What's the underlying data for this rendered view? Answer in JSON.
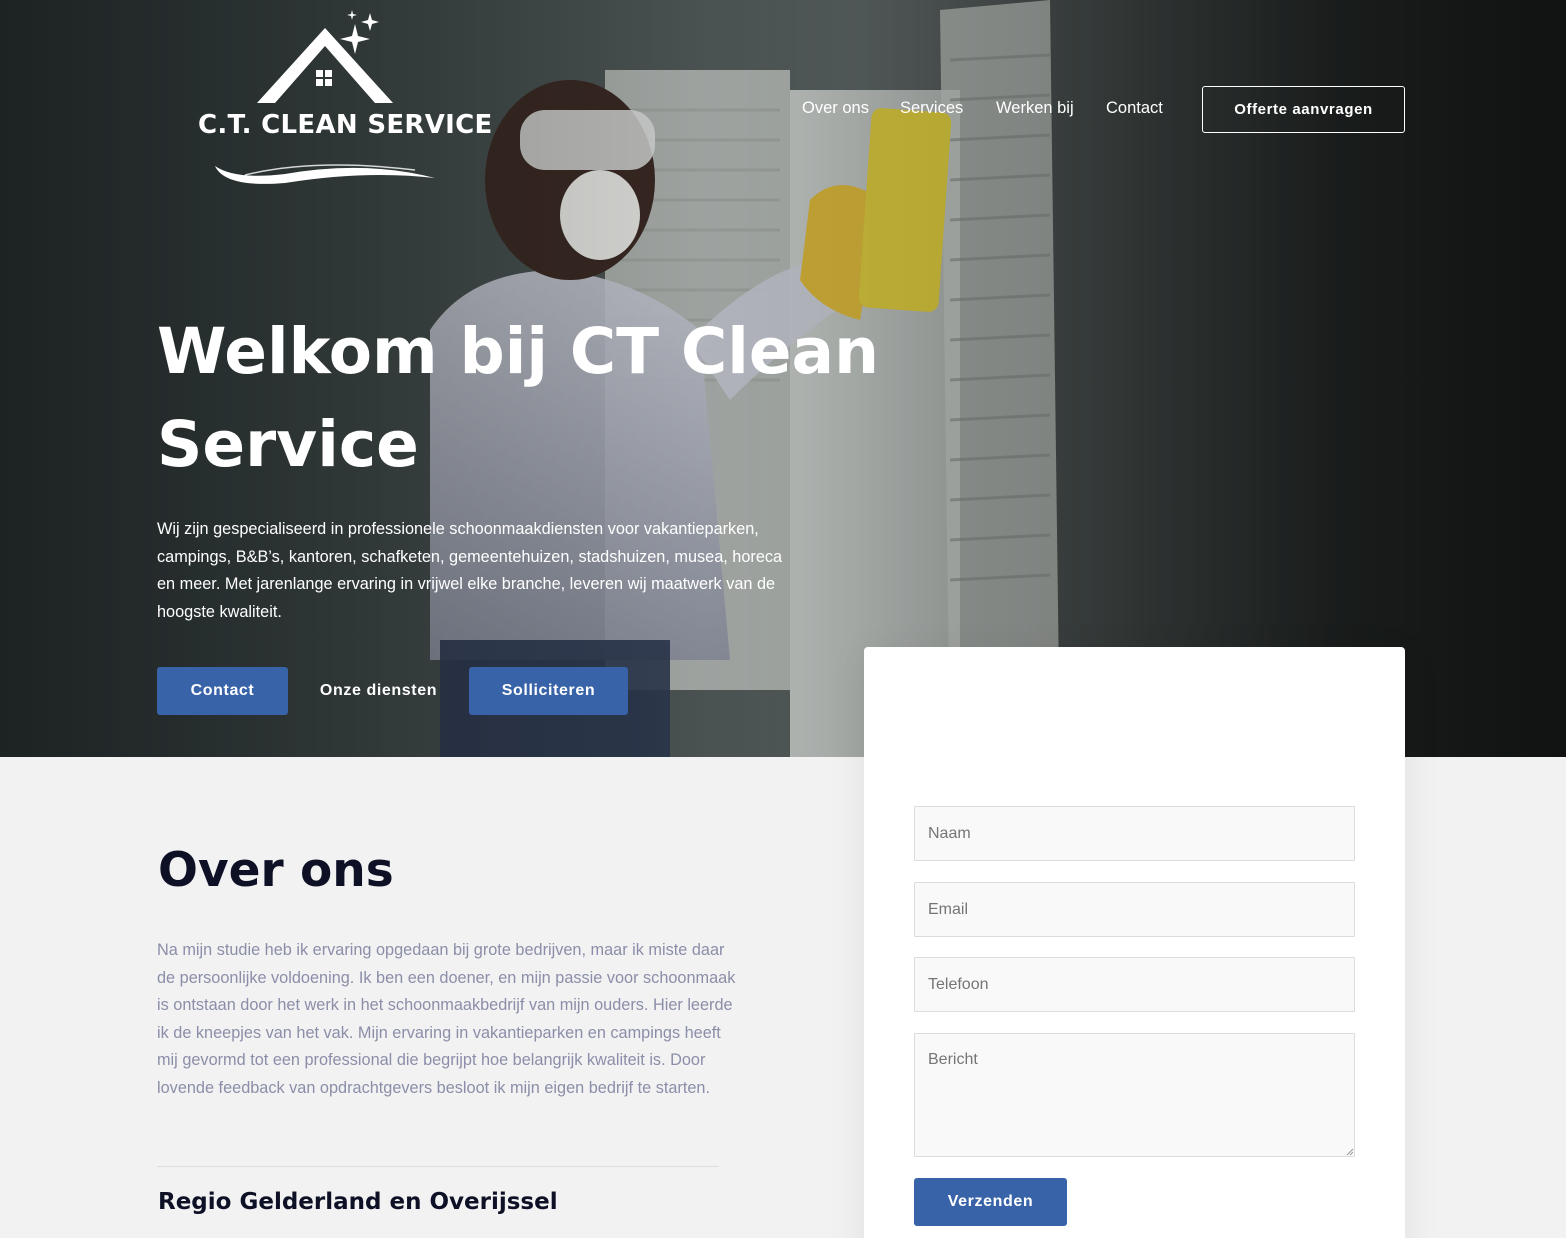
{
  "brand": {
    "logo_text": "C.T. CLEAN SERVICE"
  },
  "nav": {
    "items": [
      "Over ons",
      "Services",
      "Werken bij",
      "Contact"
    ],
    "cta_label": "Offerte aanvragen"
  },
  "hero": {
    "title": "Welkom bij CT Clean Service",
    "text": "Wij zijn gespecialiseerd in professionele schoonmaakdiensten voor vakantieparken, campings, B&B’s, kantoren, schafketen, gemeentehuizen, stadshuizen, musea, horeca en meer. Met jarenlange ervaring in vrijwel elke branche, leveren wij maatwerk van de hoogste kwaliteit.",
    "buttons": {
      "contact": "Contact",
      "diensten": "Onze diensten",
      "solliciteren": "Solliciteren"
    }
  },
  "about": {
    "title": "Over ons",
    "text": "Na mijn studie heb ik ervaring opgedaan bij grote bedrijven, maar ik miste daar de persoonlijke voldoening. Ik ben een doener, en mijn passie voor schoonmaak is ontstaan door het werk in het schoonmaakbedrijf van mijn ouders. Hier leerde ik de kneepjes van het vak. Mijn ervaring in vakantieparken en campings heeft mij gevormd tot een professional die begrijpt hoe belangrijk kwaliteit is. Door lovende feedback van opdrachtgevers besloot ik mijn eigen bedrijf te starten.",
    "region_title": "Regio Gelderland en Overijssel"
  },
  "form": {
    "name_placeholder": "Naam",
    "email_placeholder": "Email",
    "phone_placeholder": "Telefoon",
    "message_placeholder": "Bericht",
    "submit_label": "Verzenden"
  },
  "colors": {
    "primary": "#3863a9",
    "heading": "#0e1126",
    "body_text": "#8b8ea8",
    "page_bg": "#f2f2f3"
  }
}
